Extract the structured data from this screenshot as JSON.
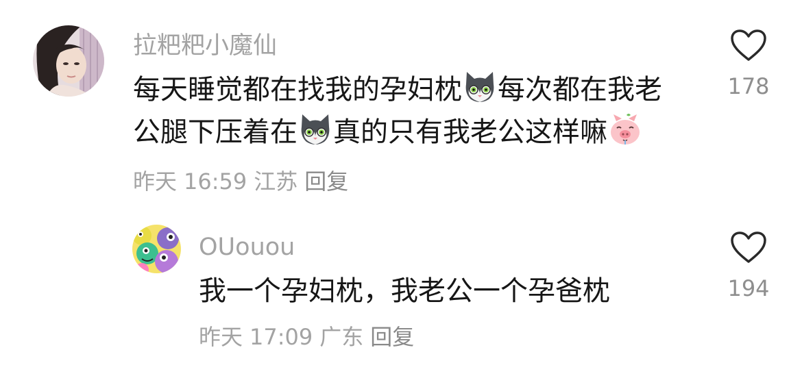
{
  "comments": [
    {
      "username": "拉粑粑小魔仙",
      "content_parts": [
        "每天睡觉都在找我的孕妇枕",
        "每次都在我老",
        "公腿下压着在",
        "真的只有我老公这样嘛"
      ],
      "emojis": [
        "cat-emoji",
        "cat-emoji",
        "pig-emoji"
      ],
      "date": "昨天",
      "time": "16:59",
      "location": "江苏",
      "reply_label": "回复",
      "like_count": "178"
    },
    {
      "username": "OUouou",
      "content": "我一个孕妇枕，我老公一个孕爸枕",
      "date": "昨天",
      "time": "17:09",
      "location": "广东",
      "reply_label": "回复",
      "like_count": "194"
    }
  ],
  "icons": {
    "like": "heart-outline-icon"
  },
  "colors": {
    "username": "#a3a3a3",
    "content": "#161616",
    "meta": "#a3a3a3",
    "like_count": "#8e8e8e"
  }
}
